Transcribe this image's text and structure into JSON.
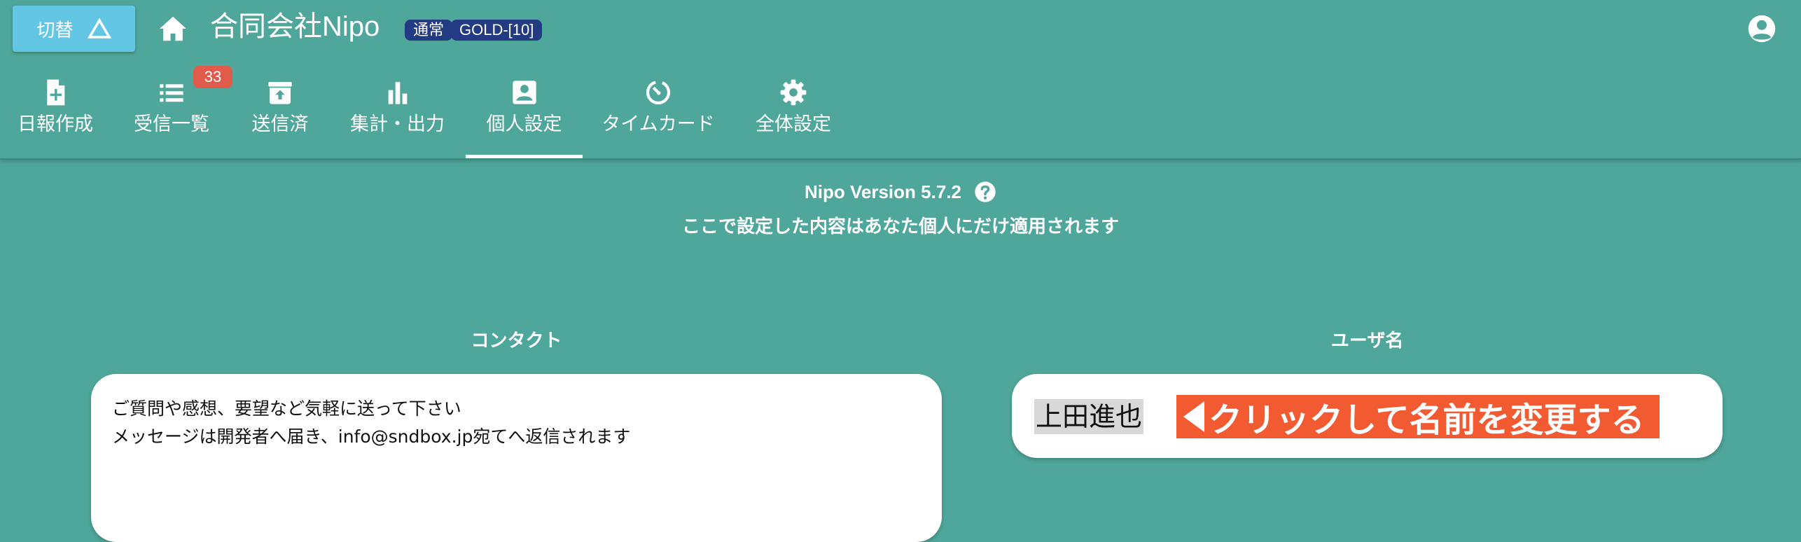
{
  "header": {
    "switch_label": "切替",
    "company_name": "合同会社Nipo",
    "badges": [
      "通常",
      "GOLD-[10]"
    ]
  },
  "tabs": [
    {
      "label": "日報作成",
      "icon": "note-add-icon"
    },
    {
      "label": "受信一覧",
      "icon": "list-icon",
      "badge": "33"
    },
    {
      "label": "送信済",
      "icon": "archive-icon"
    },
    {
      "label": "集計・出力",
      "icon": "bar-chart-icon"
    },
    {
      "label": "個人設定",
      "icon": "contact-card-icon",
      "active": true
    },
    {
      "label": "タイムカード",
      "icon": "timer-icon"
    },
    {
      "label": "全体設定",
      "icon": "gear-icon"
    }
  ],
  "info": {
    "version": "Nipo Version 5.7.2",
    "notice": "ここで設定した内容はあなた個人にだけ適用されます"
  },
  "contact": {
    "title": "コンタクト",
    "line1": "ご質問や感想、要望など気軽に送って下さい",
    "line2": "メッセージは開発者へ届き、info@sndbox.jp宛てへ返信されます"
  },
  "user": {
    "title": "ユーザ名",
    "name": "上田進也",
    "change_label": "クリックして名前を変更する"
  },
  "colors": {
    "background": "#4fa69a",
    "switch_button": "#63c6e4",
    "badge": "#233b82",
    "count_badge": "#e15b4b",
    "change_button": "#f25a32"
  }
}
